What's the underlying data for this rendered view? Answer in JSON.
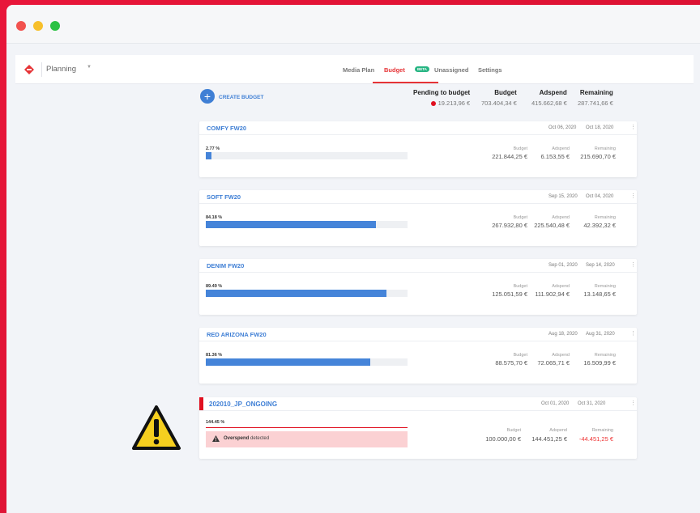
{
  "colors": {
    "accent": "#e63336",
    "link": "#3f7fd5",
    "bar": "#4584d9",
    "overspend": "#e01020"
  },
  "app": {
    "project": "Planning"
  },
  "tabs": [
    {
      "label": "Media Plan",
      "active": false
    },
    {
      "label": "Budget",
      "active": true,
      "badge": "BETA"
    },
    {
      "label": "Unassigned",
      "active": false
    },
    {
      "label": "Settings",
      "active": false
    }
  ],
  "create_label": "CREATE BUDGET",
  "summary": {
    "pending": {
      "label": "Pending to budget",
      "value": "19.213,96 €"
    },
    "budget": {
      "label": "Budget",
      "value": "703.404,34 €"
    },
    "adspend": {
      "label": "Adspend",
      "value": "415.662,68 €"
    },
    "remaining": {
      "label": "Remaining",
      "value": "287.741,66 €"
    }
  },
  "col_labels": {
    "budget": "Budget",
    "adspend": "Adspend",
    "remaining": "Remaining"
  },
  "budgets": [
    {
      "name": "COMFY FW20",
      "start": "Oct 06, 2020",
      "end": "Oct 18, 2020",
      "pct": "2.77 %",
      "progress": 0.0277,
      "budget": "221.844,25 €",
      "adspend": "6.153,55 €",
      "remaining": "215.690,70 €"
    },
    {
      "name": "SOFT FW20",
      "start": "Sep 15, 2020",
      "end": "Oct 04, 2020",
      "pct": "84.18 %",
      "progress": 0.8418,
      "budget": "267.932,80 €",
      "adspend": "225.540,48 €",
      "remaining": "42.392,32 €"
    },
    {
      "name": "DENIM FW20",
      "start": "Sep 01, 2020",
      "end": "Sep 14, 2020",
      "pct": "89.49 %",
      "progress": 0.8949,
      "budget": "125.051,59 €",
      "adspend": "111.902,94 €",
      "remaining": "13.148,65 €"
    },
    {
      "name": "RED ARIZONA FW20",
      "start": "Aug 18, 2020",
      "end": "Aug 31, 2020",
      "pct": "81.36 %",
      "progress": 0.8136,
      "budget": "88.575,70 €",
      "adspend": "72.065,71 €",
      "remaining": "16.509,99 €"
    }
  ],
  "overspend_card": {
    "name": "202010_JP_ONGOING",
    "start": "Oct 01, 2020",
    "end": "Oct 31, 2020",
    "pct": "144.45 %",
    "progress": 1.4445,
    "warning_bold": "Overspend",
    "warning_rest": "detected",
    "budget": "100.000,00 €",
    "adspend": "144.451,25 €",
    "remaining": "-44.451,25 €"
  }
}
